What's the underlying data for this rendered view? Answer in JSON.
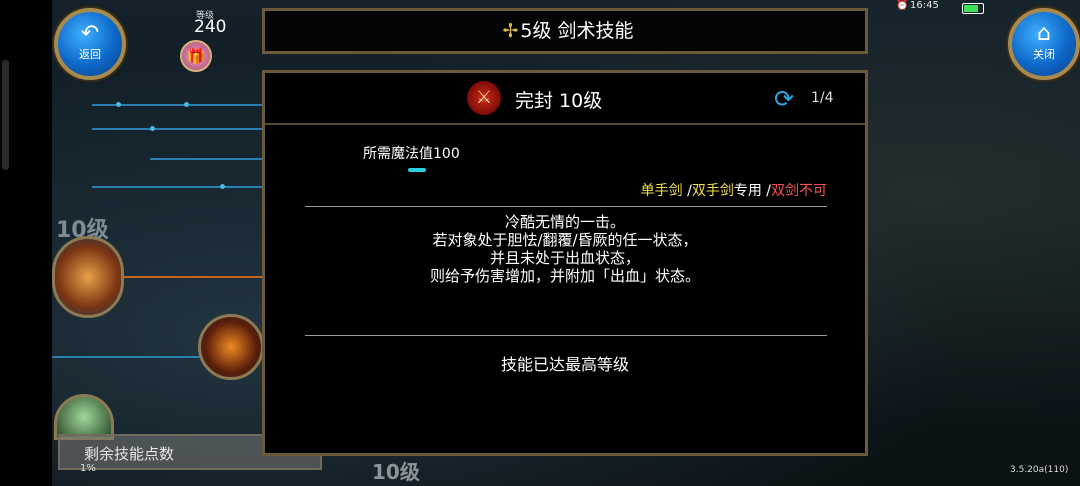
{
  "status": {
    "time": "16:45"
  },
  "player": {
    "level_label": "等级",
    "level": "240"
  },
  "buttons": {
    "back_label": "返回",
    "close_label": "关闭"
  },
  "header": {
    "title": "5级 剑术技能"
  },
  "skill": {
    "name": "完封 10级",
    "page": "1/4",
    "mp_required": "所需魔法值100",
    "weapon_single": "单手剑",
    "weapon_sep1": " /",
    "weapon_double": "双手剑",
    "weapon_only": "专用",
    "weapon_sep2": " /",
    "weapon_dual": "双剑不可",
    "description": [
      "冷酷无情的一击。",
      "若对象处于胆怯/翻覆/昏厥的任一状态，",
      "并且未处于出血状态，",
      "则给予伤害增加，并附加「出血」状态。"
    ],
    "max_text": "技能已达最高等级"
  },
  "background": {
    "level_left": "10级",
    "level_bottom": "10级",
    "remaining_points": "剩余技能点数",
    "percent": "1%"
  },
  "version": "3.5.20a(110)",
  "icons": [
    "back-arrow-icon",
    "home-icon",
    "gift-icon",
    "sword-skill-icon",
    "red-emblem-icon",
    "refresh-icon",
    "alarm-icon",
    "battery-icon"
  ],
  "colors": {
    "accent_blue": "#29a8e8",
    "weapon_yellow": "#f5df4a",
    "weapon_red": "#ff5050",
    "frame_gold": "#6b5a3a"
  }
}
